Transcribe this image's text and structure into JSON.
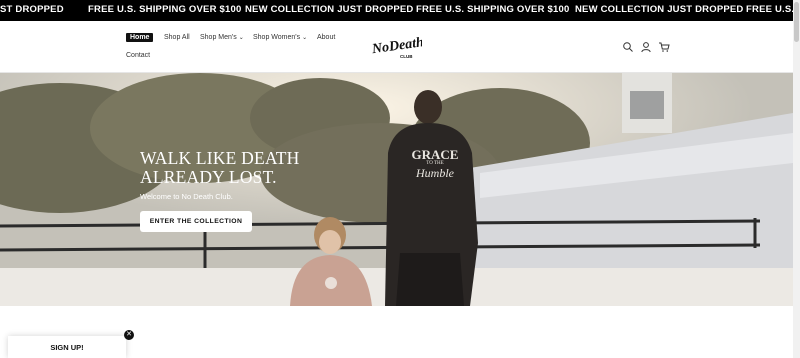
{
  "announcement": {
    "messages": [
      "ST DROPPED",
      "FREE U.S. SHIPPING OVER $100",
      "NEW COLLECTION JUST DROPPED",
      "FREE U.S. SHIPPING OVER $100",
      "NEW COLLECTION JUST DROPPED",
      "FREE U.S. S"
    ]
  },
  "nav": {
    "items": [
      {
        "label": "Home"
      },
      {
        "label": "Shop All"
      },
      {
        "label": "Shop Men's",
        "chevron": "⌄"
      },
      {
        "label": "Shop Women's",
        "chevron": "⌄"
      },
      {
        "label": "About"
      },
      {
        "label": "Contact"
      }
    ]
  },
  "logo": {
    "text": "NoDeath",
    "subtext": "CLUB"
  },
  "header_icons": [
    "search-icon",
    "account-icon",
    "cart-icon"
  ],
  "hero": {
    "title_line1": "WALK LIKE DEATH",
    "title_line2": "ALREADY LOST.",
    "subtitle": "Welcome to No Death Club.",
    "button_label": "ENTER THE COLLECTION",
    "hoodie_text1": "GRACE",
    "hoodie_text2": "TO THE",
    "hoodie_text3": "Humble"
  },
  "signup": {
    "label": "SIGN UP!",
    "close": "✕"
  },
  "colors": {
    "announcement_bg": "#000000",
    "accent": "#111111"
  }
}
